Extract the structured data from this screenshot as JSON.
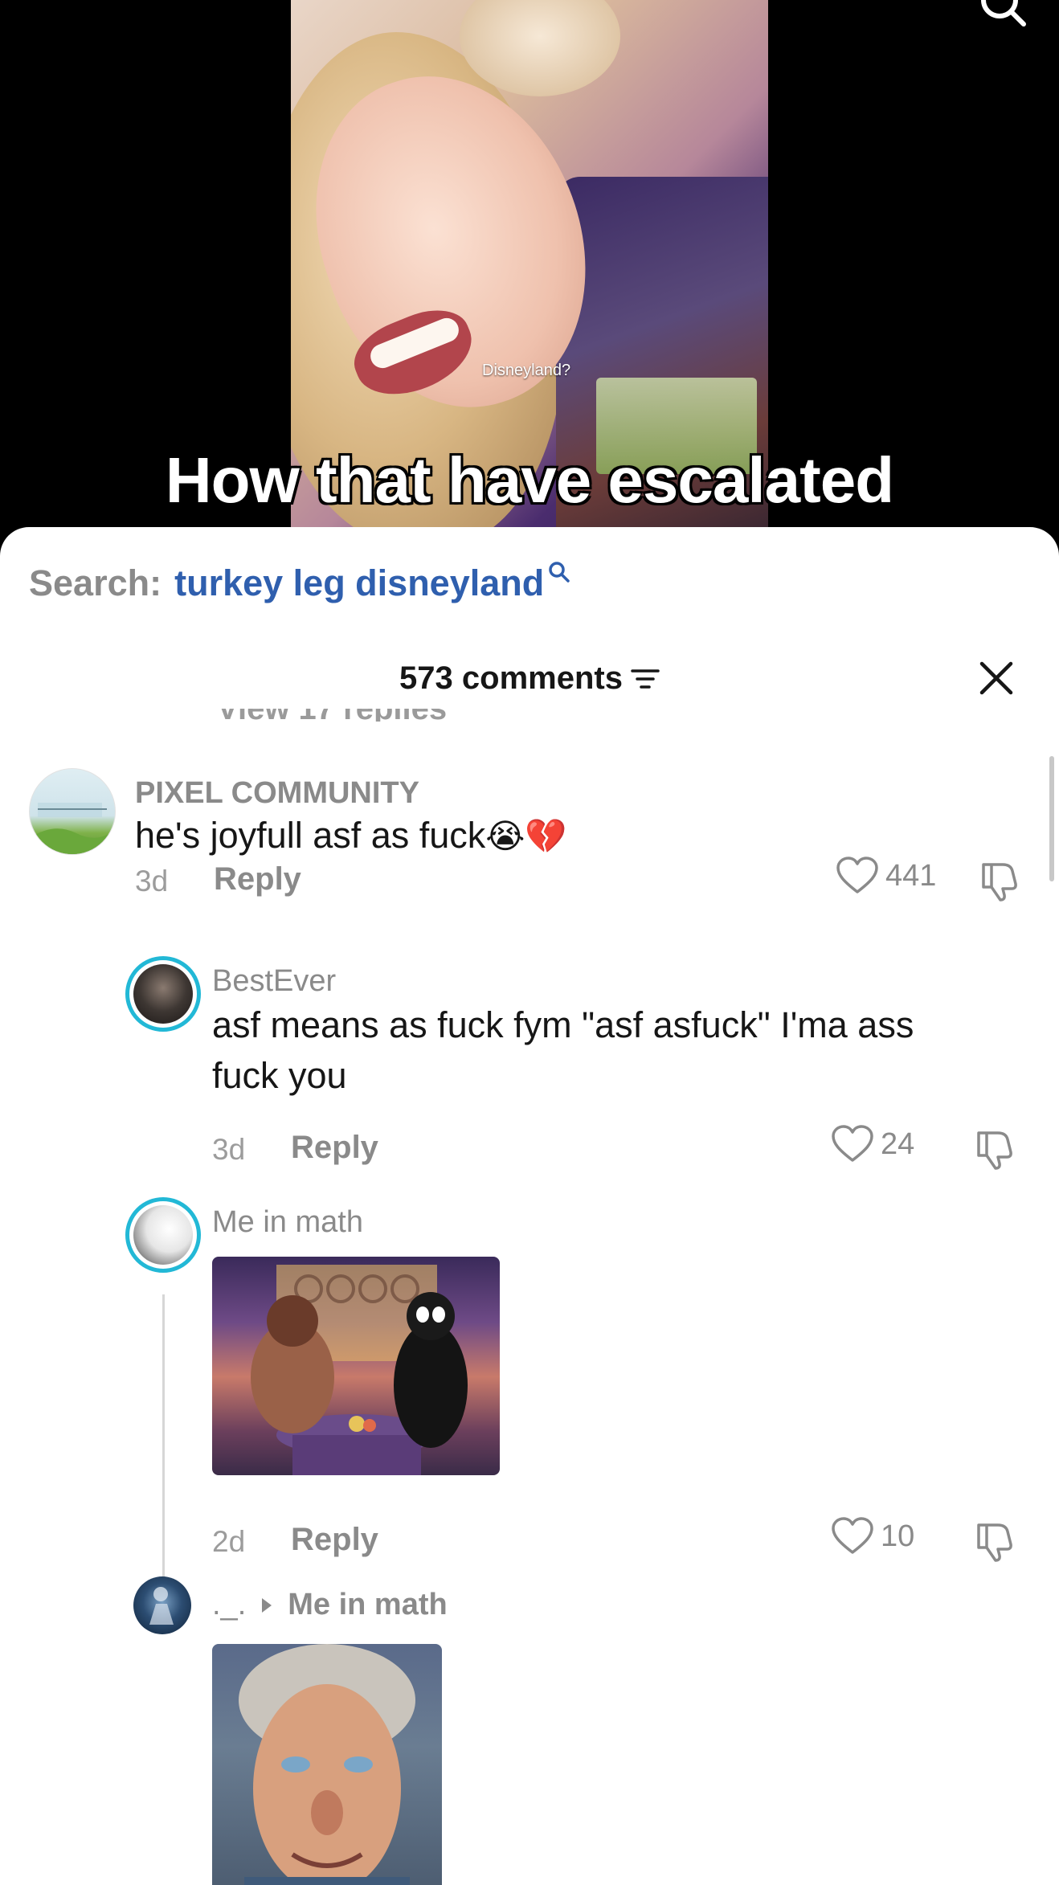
{
  "video": {
    "overlay_label": "Disneyland?",
    "caption": "How that have escalated"
  },
  "search": {
    "prefix": "Search:",
    "term": "turkey leg disneyland"
  },
  "comments_header": {
    "count_label": "573 comments"
  },
  "replies_stub": "View 17 replies",
  "comments": [
    {
      "author": "PIXEL COMMUNITY",
      "text": "he's joyfull asf as fuck",
      "emojis": "😭💔",
      "age": "3d",
      "reply_label": "Reply",
      "likes": "441"
    },
    {
      "author": "BestEver",
      "text": "asf means as fuck fym \"asf asfuck\" I'ma ass fuck you",
      "age": "3d",
      "reply_label": "Reply",
      "likes": "24"
    },
    {
      "author": "Me in math",
      "attachment": "image",
      "age": "2d",
      "reply_label": "Reply",
      "likes": "10"
    },
    {
      "author": "._.",
      "reply_to": "Me in math",
      "attachment": "image"
    }
  ],
  "colors": {
    "accent_link": "#2f5fae",
    "text_primary": "#161616",
    "text_secondary": "#8a8a8a",
    "avatar_ring": "#22b8d6"
  }
}
